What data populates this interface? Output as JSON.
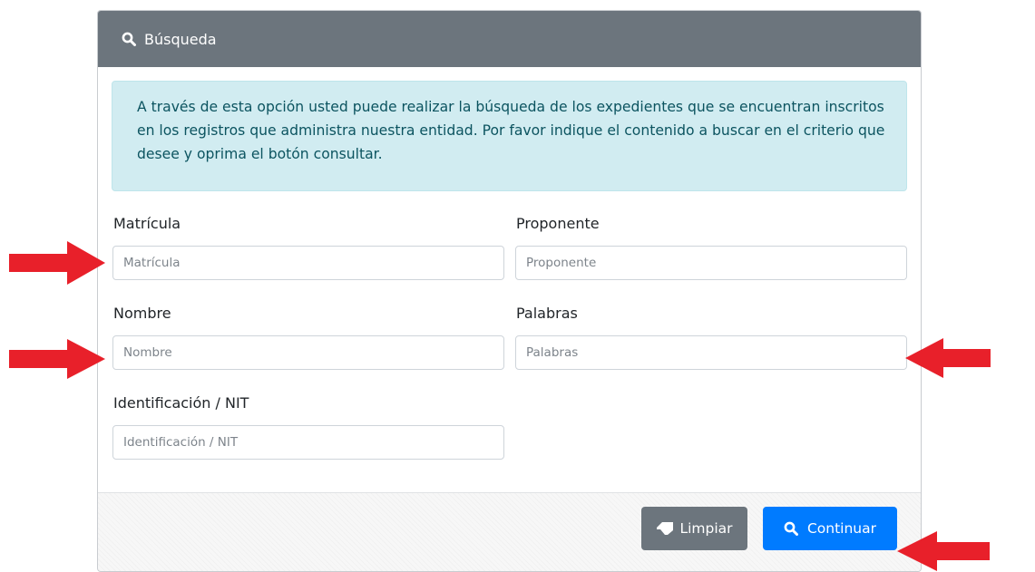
{
  "header": {
    "title": "Búsqueda",
    "icon": "search-icon"
  },
  "info": {
    "text": "A través de esta opción usted puede realizar la búsqueda de los expedientes que se encuentran inscritos en los registros que administra nuestra entidad. Por favor indique el contenido a buscar en el criterio que desee y oprima el botón consultar."
  },
  "form": {
    "matricula": {
      "label": "Matrícula",
      "placeholder": "Matrícula",
      "value": ""
    },
    "proponente": {
      "label": "Proponente",
      "placeholder": "Proponente",
      "value": ""
    },
    "nombre": {
      "label": "Nombre",
      "placeholder": "Nombre",
      "value": ""
    },
    "palabras": {
      "label": "Palabras",
      "placeholder": "Palabras",
      "value": ""
    },
    "identificacion": {
      "label": "Identificación / NIT",
      "placeholder": "Identificación / NIT",
      "value": ""
    }
  },
  "buttons": {
    "limpiar": {
      "label": "Limpiar",
      "icon": "eraser-icon"
    },
    "continuar": {
      "label": "Continuar",
      "icon": "search-icon"
    }
  },
  "colors": {
    "header_bg": "#6c757d",
    "alert_bg": "#d1ecf1",
    "alert_text": "#0c5460",
    "primary": "#007bff",
    "secondary": "#6c757d",
    "arrow": "#e8202a"
  }
}
